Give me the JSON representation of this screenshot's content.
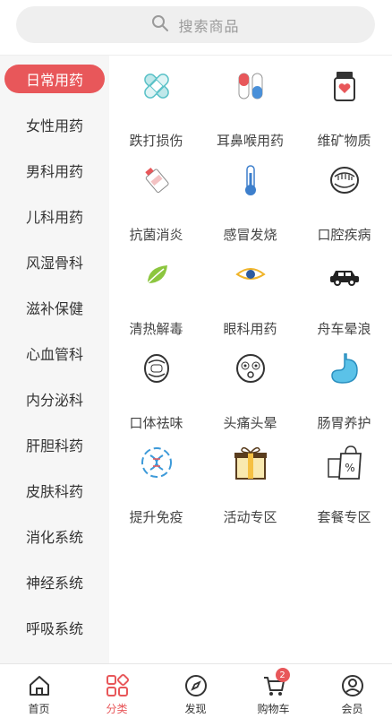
{
  "search": {
    "placeholder": "搜索商品",
    "icon": "search-icon"
  },
  "sidebar": {
    "items": [
      {
        "label": "日常用药",
        "active": true
      },
      {
        "label": "女性用药"
      },
      {
        "label": "男科用药"
      },
      {
        "label": "儿科用药"
      },
      {
        "label": "风湿骨科"
      },
      {
        "label": "滋补保健"
      },
      {
        "label": "心血管科"
      },
      {
        "label": "内分泌科"
      },
      {
        "label": "肝胆科药"
      },
      {
        "label": "皮肤科药"
      },
      {
        "label": "消化系统"
      },
      {
        "label": "神经系统"
      },
      {
        "label": "呼吸系统"
      }
    ]
  },
  "categories": [
    {
      "label": "跌打损伤",
      "icon": "bandage-icon"
    },
    {
      "label": "耳鼻喉用药",
      "icon": "capsule-icon"
    },
    {
      "label": "维矿物质",
      "icon": "vitamin-bottle-icon"
    },
    {
      "label": "抗菌消炎",
      "icon": "ointment-tube-icon"
    },
    {
      "label": "感冒发烧",
      "icon": "thermometer-icon"
    },
    {
      "label": "口腔疾病",
      "icon": "mouth-icon"
    },
    {
      "label": "清热解毒",
      "icon": "leaf-icon"
    },
    {
      "label": "眼科用药",
      "icon": "eye-icon"
    },
    {
      "label": "舟车晕浪",
      "icon": "car-icon"
    },
    {
      "label": "口体祛味",
      "icon": "mouth-teeth-icon"
    },
    {
      "label": "头痛头晕",
      "icon": "dizzy-face-icon"
    },
    {
      "label": "肠胃养护",
      "icon": "stomach-icon"
    },
    {
      "label": "提升免疫",
      "icon": "dna-icon"
    },
    {
      "label": "活动专区",
      "icon": "gift-box-icon"
    },
    {
      "label": "套餐专区",
      "icon": "shopping-bag-icon"
    }
  ],
  "tabbar": {
    "items": [
      {
        "label": "首页",
        "icon": "home-icon"
      },
      {
        "label": "分类",
        "icon": "category-icon",
        "active": true
      },
      {
        "label": "发现",
        "icon": "compass-icon"
      },
      {
        "label": "购物车",
        "icon": "cart-icon",
        "badge": "2"
      },
      {
        "label": "会员",
        "icon": "user-icon"
      }
    ]
  },
  "colors": {
    "accent": "#e8575a",
    "sidebar_bg": "#f6f6f6",
    "search_bg": "#efefef"
  }
}
